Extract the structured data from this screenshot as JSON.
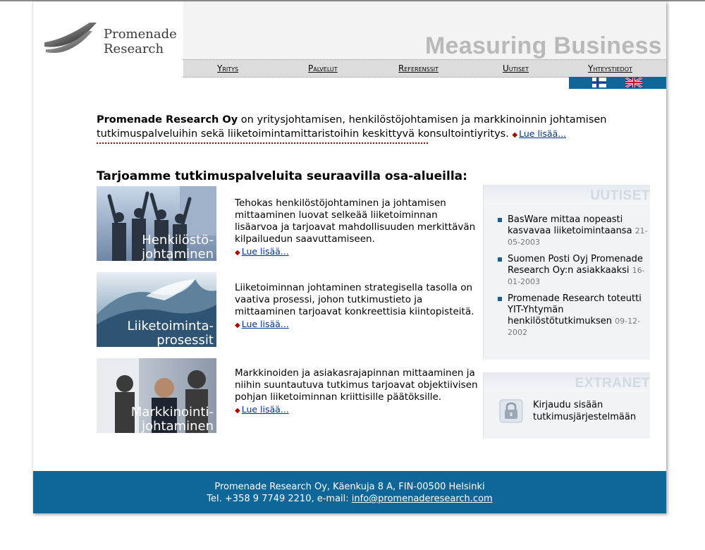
{
  "brand": {
    "name_line1": "Promenade",
    "name_line2": "Research",
    "tagline": "Measuring Business"
  },
  "nav": {
    "items": [
      "Yritys",
      "Palvelut",
      "Referenssit",
      "Uutiset",
      "Yhteystiedot"
    ]
  },
  "flags": [
    "finnish-flag",
    "uk-flag"
  ],
  "intro": {
    "company": "Promenade Research Oy",
    "text": " on yritysjohtamisen, henkilöstöjohtamisen ja markkinoinnin johtamisen tutkimuspalveluihin sekä liiketoimintamittaristoihin keskittyvä konsultointiyritys.",
    "more": "Lue lisää..."
  },
  "section_title": "Tarjoamme tutkimuspalveluita seuraavilla osa-alueilla:",
  "services": [
    {
      "img_line1": "Henkilöstö-",
      "img_line2": "johtaminen",
      "text": "Tehokas henkilöstöjohtaminen ja johtamisen mittaaminen luovat selkeää liiketoiminnan lisäarvoa ja tarjoavat mahdollisuuden merkittävän kilpailuedun saavuttamiseen.",
      "more": "Lue lisää..."
    },
    {
      "img_line1": "Liiketoiminta-",
      "img_line2": "prosessit",
      "text": "Liiketoiminnan johtaminen strategisella tasolla on vaativa prosessi, johon tutkimustieto ja mittaaminen tarjoavat konkreettisia kiintopisteitä.",
      "more": "Lue lisää..."
    },
    {
      "img_line1": "Markkinointi-",
      "img_line2": "johtaminen",
      "text": "Markkinoiden ja asiakasrajapinnan mittaaminen ja niihin suuntautuva tutkimus tarjoavat objektiivisen pohjan liiketoiminnan kriittisille päätöksille.",
      "more": "Lue lisää..."
    }
  ],
  "news": {
    "title": "UUTISET",
    "items": [
      {
        "text": "BasWare mittaa nopeasti kasvavaa liiketoimintaansa",
        "date": "21-05-2003"
      },
      {
        "text": "Suomen Posti Oyj Promenade Research Oy:n asiakkaaksi",
        "date": "16-01-2003"
      },
      {
        "text": "Promenade Research toteutti YIT-Yhtymän henkilöstötutkimuksen",
        "date": "09-12-2002"
      }
    ]
  },
  "extranet": {
    "title": "EXTRANET",
    "line1": "Kirjaudu sisään",
    "line2": "tutkimusjärjestelmään",
    "icon": "lock-icon"
  },
  "footer": {
    "address": "Promenade Research Oy, Käenkuja 8 A, FIN-00500 Helsinki",
    "contact": "Tel. +358 9 7749 2210, e-mail: ",
    "email": "info@promenaderesearch.com"
  },
  "colors": {
    "accent": "#0f6799",
    "link": "#00338f",
    "rule": "#b30000",
    "tagline": "#b9b9b9"
  }
}
